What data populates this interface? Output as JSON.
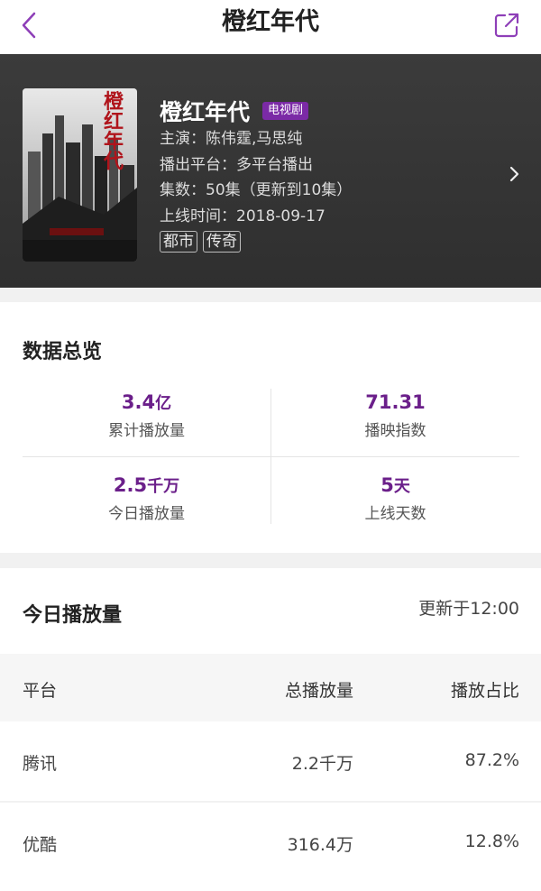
{
  "nav": {
    "title": "橙红年代",
    "back_icon": "chevron-left-icon",
    "share_icon": "share-icon",
    "accent": "#8e3fb8"
  },
  "drama": {
    "title": "橙红年代",
    "badge": "电视剧",
    "cast": "主演：陈伟霆,马思纯",
    "platform": "播出平台：多平台播出",
    "episodes": "集数：50集（更新到10集）",
    "release": "上线时间：2018-09-17",
    "tags": [
      "都市",
      "传奇"
    ],
    "poster_title": "橙红年代"
  },
  "overview": {
    "title": "数据总览",
    "stats": [
      {
        "value": "3.4",
        "unit": "亿",
        "label": "累计播放量"
      },
      {
        "value": "71.31",
        "unit": "",
        "label": "播映指数"
      },
      {
        "value": "2.5",
        "unit": "千万",
        "label": "今日播放量"
      },
      {
        "value": "5",
        "unit": "天",
        "label": "上线天数"
      }
    ],
    "value_color": "#6b1f8a"
  },
  "today": {
    "title": "今日播放量",
    "updated": "更新于12:00",
    "columns": [
      "平台",
      "总播放量",
      "播放占比"
    ],
    "rows": [
      {
        "platform": "腾讯",
        "total": "2.2千万",
        "share": "87.2%"
      },
      {
        "platform": "优酷",
        "total": "316.4万",
        "share": "12.8%"
      }
    ]
  }
}
